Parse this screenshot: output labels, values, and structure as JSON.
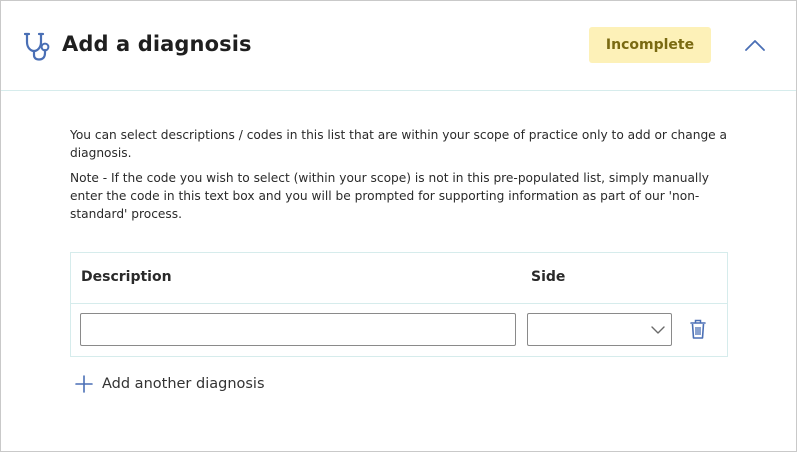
{
  "header": {
    "title": "Add a diagnosis",
    "status_badge": "Incomplete",
    "icon": "stethoscope-icon",
    "collapse_icon": "chevron-up-icon"
  },
  "intro": {
    "paragraph1": "You can select descriptions / codes in this list that are within your scope of practice only to add or change a diagnosis.",
    "paragraph2": "Note - If the code you wish to select (within your scope) is not in this pre-populated list, simply manually enter the code in this text box and you will be prompted for supporting information as part of our 'non-standard' process."
  },
  "table": {
    "columns": [
      "Description",
      "Side"
    ],
    "rows": [
      {
        "description": "",
        "side": ""
      }
    ],
    "delete_icon": "trash-icon"
  },
  "add_button": {
    "label": "Add another diagnosis",
    "icon": "plus-icon"
  },
  "colors": {
    "badge_bg": "#fdf1b8",
    "badge_text": "#7a6a12",
    "icon_blue": "#4a6fb5",
    "divider": "#d6ecec"
  }
}
